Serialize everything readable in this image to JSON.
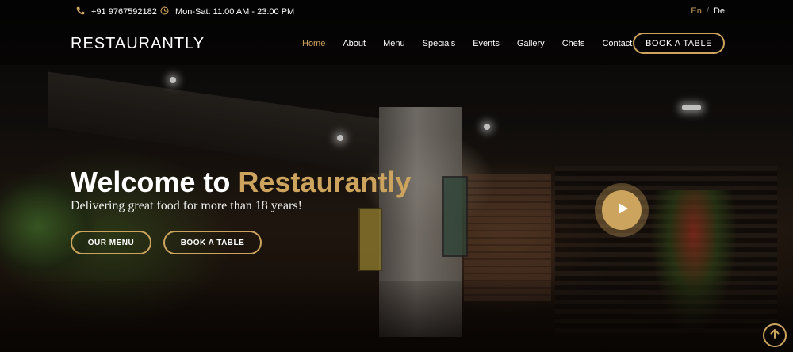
{
  "topbar": {
    "phone": "+91 9767592182",
    "hours": "Mon-Sat: 11:00 AM - 23:00 PM",
    "lang_active": "En",
    "lang_sep": "/",
    "lang_other": "De"
  },
  "header": {
    "logo": "RESTAURANTLY",
    "nav": [
      "Home",
      "About",
      "Menu",
      "Specials",
      "Events",
      "Gallery",
      "Chefs",
      "Contact"
    ],
    "active_nav": "Home",
    "book_button": "BOOK A TABLE"
  },
  "hero": {
    "welcome_prefix": "Welcome to ",
    "brand": "Restaurantly",
    "tagline": "Delivering great food for more than 18 years!",
    "btn_menu": "OUR MENU",
    "btn_book": "BOOK A TABLE"
  },
  "icons": {
    "phone": "phone-icon",
    "clock": "clock-icon",
    "play": "play-icon",
    "back_to_top": "arrow-up-icon"
  },
  "colors": {
    "accent": "#cda45e",
    "background": "#0c0b0a",
    "text": "#ffffff"
  }
}
